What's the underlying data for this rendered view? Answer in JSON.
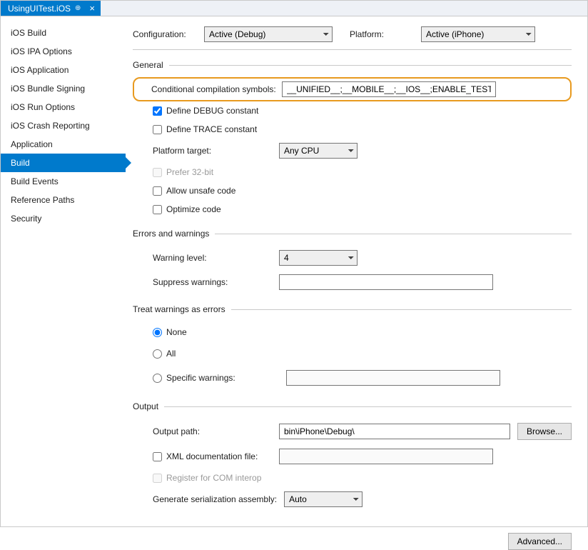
{
  "tab": {
    "title": "UsingUITest.iOS"
  },
  "sidebar": {
    "items": [
      "iOS Build",
      "iOS IPA Options",
      "iOS Application",
      "iOS Bundle Signing",
      "iOS Run Options",
      "iOS Crash Reporting",
      "Application",
      "Build",
      "Build Events",
      "Reference Paths",
      "Security"
    ],
    "selected_index": 7
  },
  "config": {
    "configuration_label": "Configuration:",
    "configuration_value": "Active (Debug)",
    "platform_label": "Platform:",
    "platform_value": "Active (iPhone)"
  },
  "general": {
    "heading": "General",
    "cond_comp_label": "Conditional compilation symbols:",
    "cond_comp_value": "__UNIFIED__;__MOBILE__;__IOS__;ENABLE_TEST_CLOUD;",
    "define_debug": "Define DEBUG constant",
    "define_debug_checked": true,
    "define_trace": "Define TRACE constant",
    "define_trace_checked": false,
    "platform_target_label": "Platform target:",
    "platform_target_value": "Any CPU",
    "prefer32": "Prefer 32-bit",
    "allow_unsafe": "Allow unsafe code",
    "optimize": "Optimize code"
  },
  "errors": {
    "heading": "Errors and warnings",
    "warning_level_label": "Warning level:",
    "warning_level_value": "4",
    "suppress_label": "Suppress warnings:",
    "suppress_value": ""
  },
  "treat": {
    "heading": "Treat warnings as errors",
    "none": "None",
    "all": "All",
    "specific": "Specific warnings:",
    "selected": "none",
    "specific_value": ""
  },
  "output": {
    "heading": "Output",
    "path_label": "Output path:",
    "path_value": "bin\\iPhone\\Debug\\",
    "browse": "Browse...",
    "xml_doc": "XML documentation file:",
    "register_com": "Register for COM interop",
    "gen_serialization_label": "Generate serialization assembly:",
    "gen_serialization_value": "Auto",
    "advanced": "Advanced..."
  }
}
